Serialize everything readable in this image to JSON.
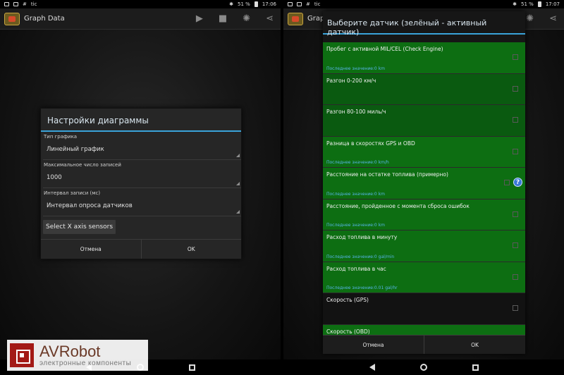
{
  "left_screen": {
    "status": {
      "left_glyphs": "#",
      "left_text": "tic",
      "battery": "51 %",
      "time": "17:06"
    },
    "app_title": "Graph Data",
    "dialog": {
      "title": "Настройки диаграммы",
      "fields": [
        {
          "label": "Тип графика",
          "value": "Линейный график"
        },
        {
          "label": "Максимальное число записей",
          "value": "1000"
        },
        {
          "label": "Интервал записи (мс)",
          "value": "Интервал опроса датчиков"
        }
      ],
      "x_axis_button": "Select X axis sensors",
      "cancel": "Отмена",
      "ok": "OK"
    }
  },
  "right_screen": {
    "status": {
      "left_glyphs": "#",
      "left_text": "tic",
      "battery": "51 %",
      "time": "17:07"
    },
    "app_title": "Graph",
    "dialog": {
      "title": "Выберите датчик (зелёный - активный датчик)",
      "sensors": [
        {
          "name": "Пробег с активной MIL/CEL (Check Engine)",
          "last_value": "Последнее значение:0 km",
          "active": true
        },
        {
          "name": "Разгон 0-200 км/ч",
          "last_value": "",
          "active": true
        },
        {
          "name": "Разгон 80-100 миль/ч",
          "last_value": "",
          "active": true
        },
        {
          "name": "Разница в скоростях GPS и OBD",
          "last_value": "Последнее значение:0 km/h",
          "active": true
        },
        {
          "name": "Расстояние на остатке топлива (примерно)",
          "last_value": "Последнее значение:0 km",
          "active": true
        },
        {
          "name": "Расстояние, пройденное с момента сброса ошибок",
          "last_value": "Последнее значение:0 km",
          "active": true
        },
        {
          "name": "Расход топлива в минуту",
          "last_value": "Последнее значение:0 gal/min",
          "active": true
        },
        {
          "name": "Расход топлива в час",
          "last_value": "Последнее значение:0.01 gal/hr",
          "active": true
        },
        {
          "name": "Скорость (GPS)",
          "last_value": "",
          "active": false
        },
        {
          "name": "Скорость (OBD)",
          "last_value": "",
          "active": true
        }
      ],
      "help_glyph": "?",
      "cancel": "Отмена",
      "ok": "OK"
    }
  },
  "watermark": {
    "brand": "AVRobot",
    "subtitle": "электронные компоненты"
  },
  "colors": {
    "accent": "#3aa3d9",
    "active_green": "#0d6e12",
    "value_blue": "#57b4e8"
  }
}
